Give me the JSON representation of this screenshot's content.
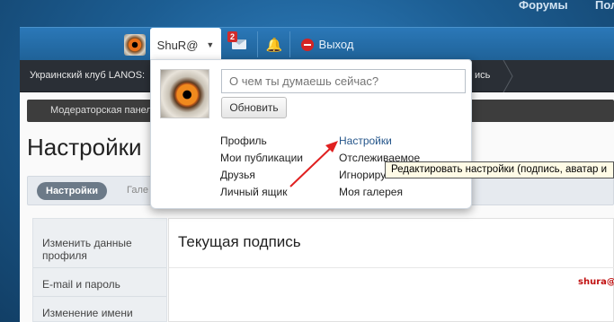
{
  "topnav": {
    "forums": "Форумы",
    "extra": "Пол"
  },
  "userbar": {
    "username": "ShuR@",
    "messages_badge": "2",
    "logout": "Выход",
    "avatar_icon": "owl-eye-avatar",
    "mail_icon": "envelope-icon",
    "bell_icon": "bell-icon",
    "logout_icon": "no-entry-icon"
  },
  "breadcrumb": {
    "left": "Украинский клуб LANOS: ",
    "right": "ись"
  },
  "modbar": {
    "label": "Модераторская панель"
  },
  "page": {
    "title": "Настройки"
  },
  "tabs": {
    "active": "Настройки",
    "next": "Гале"
  },
  "sidebar": {
    "items": [
      "Изменить данные профиля",
      "E-mail и пароль",
      "Изменение имени"
    ]
  },
  "content": {
    "heading": "Текущая подпись",
    "signature": "shura@l"
  },
  "dropdown": {
    "status_placeholder": "О чем ты думаешь сейчас?",
    "update_button": "Обновить",
    "col1": [
      "Профиль",
      "Мои публикации",
      "Друзья",
      "Личный ящик"
    ],
    "col2": [
      "Настройки",
      "Отслеживаемое",
      "Игнориру",
      "Моя галерея"
    ]
  },
  "tooltip": {
    "text": "Редактировать настройки (подпись, аватар и"
  },
  "colors": {
    "userbar": "#2b78b8",
    "crumbbar": "#2a2f36",
    "accent_link": "#24558a",
    "annotation_arrow": "#e02020",
    "badge": "#d12b2b"
  }
}
